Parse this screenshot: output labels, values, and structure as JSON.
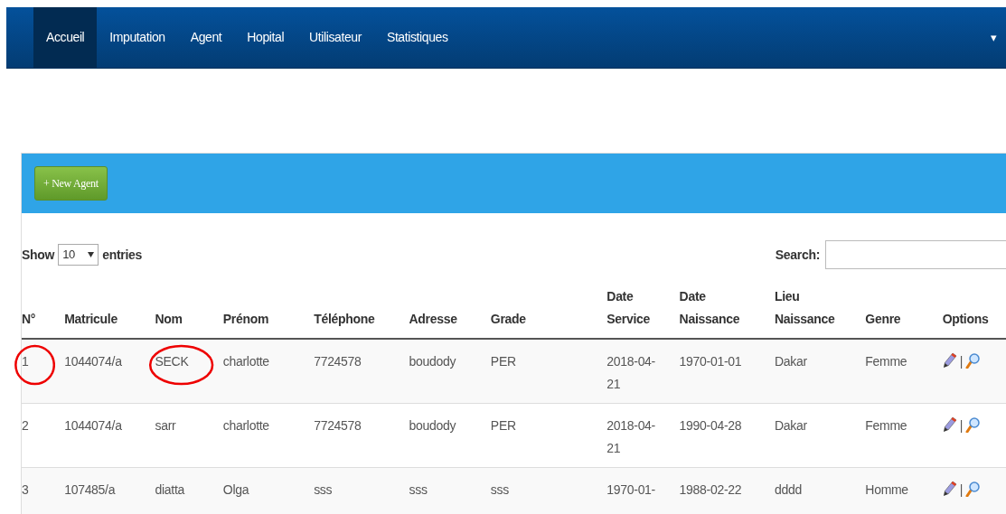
{
  "navbar": {
    "items": [
      {
        "label": "Accueil",
        "selected": true
      },
      {
        "label": "Imputation",
        "selected": false
      },
      {
        "label": "Agent",
        "selected": false
      },
      {
        "label": "Hopital",
        "selected": false
      },
      {
        "label": "Utilisateur",
        "selected": false
      },
      {
        "label": "Statistiques",
        "selected": false
      }
    ],
    "dropdown_caret": "▾"
  },
  "panel": {
    "new_button": "+ New Agent",
    "length": {
      "before": "Show",
      "value": "10",
      "after": "entries"
    },
    "search": {
      "label": "Search:"
    },
    "table": {
      "columns": [
        "N°",
        "Matricule",
        "Nom",
        "Prénom",
        "Téléphone",
        "Adresse",
        "Grade",
        "Date Service",
        "Date Naissance",
        "Lieu Naissance",
        "Genre",
        "Options"
      ],
      "rows": [
        {
          "cells": [
            "1",
            "1044074/a",
            "SECK",
            "charlotte",
            "7724578",
            "boudody",
            "PER",
            "2018-04-21",
            "1970-01-01",
            "Dakar",
            "Femme"
          ],
          "circled": [
            true,
            false,
            true,
            false,
            false,
            false,
            false,
            false,
            false,
            false,
            false
          ],
          "separator": "|"
        },
        {
          "cells": [
            "2",
            "1044074/a",
            "sarr",
            "charlotte",
            "7724578",
            "boudody",
            "PER",
            "2018-04-21",
            "1990-04-28",
            "Dakar",
            "Femme"
          ],
          "circled": [
            false,
            false,
            false,
            false,
            false,
            false,
            false,
            false,
            false,
            false,
            false
          ],
          "separator": "|"
        },
        {
          "cells": [
            "3",
            "107485/a",
            "diatta",
            "Olga",
            "sss",
            "sss",
            "sss",
            "1970-01-",
            "1988-02-22",
            "dddd",
            "Homme"
          ],
          "circled": [
            false,
            false,
            false,
            false,
            false,
            false,
            false,
            false,
            false,
            false,
            false
          ],
          "separator": "|"
        }
      ]
    }
  }
}
